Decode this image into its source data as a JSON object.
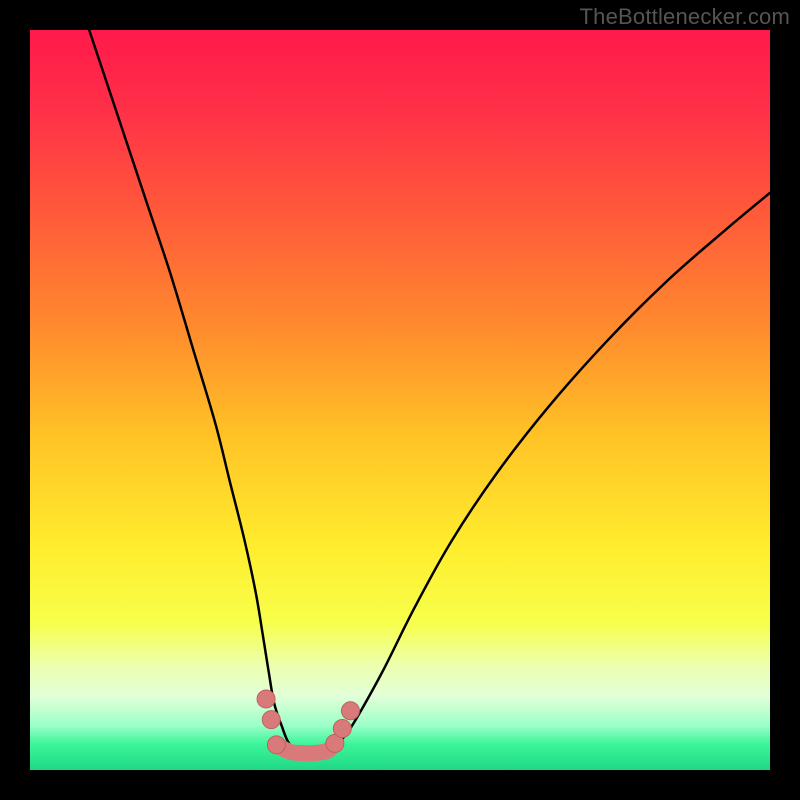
{
  "watermark": {
    "text": "TheBottlenecker.com"
  },
  "colors": {
    "background": "#000000",
    "curve_main": "#000000",
    "marker_fill": "#d97a7a",
    "marker_stroke": "#c25f5f",
    "gradient_stops": [
      {
        "offset": 0.0,
        "color": "#ff1a4b"
      },
      {
        "offset": 0.1,
        "color": "#ff2e48"
      },
      {
        "offset": 0.25,
        "color": "#ff5a3a"
      },
      {
        "offset": 0.4,
        "color": "#ff8a2e"
      },
      {
        "offset": 0.55,
        "color": "#ffc326"
      },
      {
        "offset": 0.7,
        "color": "#ffed2e"
      },
      {
        "offset": 0.8,
        "color": "#f7ff4a"
      },
      {
        "offset": 0.86,
        "color": "#ecffb0"
      },
      {
        "offset": 0.9,
        "color": "#e2ffd8"
      },
      {
        "offset": 0.94,
        "color": "#9bffc8"
      },
      {
        "offset": 0.965,
        "color": "#3cf59a"
      },
      {
        "offset": 1.0,
        "color": "#1fd885"
      }
    ]
  },
  "chart_data": {
    "type": "line",
    "title": "",
    "xlabel": "",
    "ylabel": "",
    "xlim": [
      0,
      100
    ],
    "ylim": [
      0,
      100
    ],
    "series": [
      {
        "name": "left-curve",
        "x": [
          8,
          10,
          13,
          16,
          19,
          22,
          25,
          27,
          29,
          30.5,
          31.5,
          32.3,
          33,
          34,
          35,
          36.5,
          38.5
        ],
        "y": [
          100,
          94,
          85,
          76,
          67,
          57,
          47,
          39,
          31,
          24,
          18,
          13,
          9,
          6,
          3.6,
          2.3,
          2.1
        ]
      },
      {
        "name": "right-curve",
        "x": [
          38.5,
          40,
          41.5,
          43,
          45,
          48,
          52,
          57,
          63,
          70,
          78,
          86,
          94,
          100
        ],
        "y": [
          2.1,
          2.4,
          3.5,
          5.2,
          8.5,
          14,
          22,
          31,
          40,
          49,
          58,
          66,
          73,
          78
        ]
      },
      {
        "name": "valley-bridge",
        "x": [
          33.3,
          35,
          36.5,
          38.5,
          40.2,
          41.2
        ],
        "y": [
          3.4,
          2.5,
          2.3,
          2.3,
          2.6,
          3.6
        ],
        "stroke_width": 16,
        "stroke": "marker"
      }
    ],
    "markers": [
      {
        "x": 31.9,
        "y": 9.6
      },
      {
        "x": 32.6,
        "y": 6.8
      },
      {
        "x": 33.3,
        "y": 3.4
      },
      {
        "x": 41.2,
        "y": 3.6
      },
      {
        "x": 42.2,
        "y": 5.6
      },
      {
        "x": 43.3,
        "y": 8.0
      }
    ]
  }
}
